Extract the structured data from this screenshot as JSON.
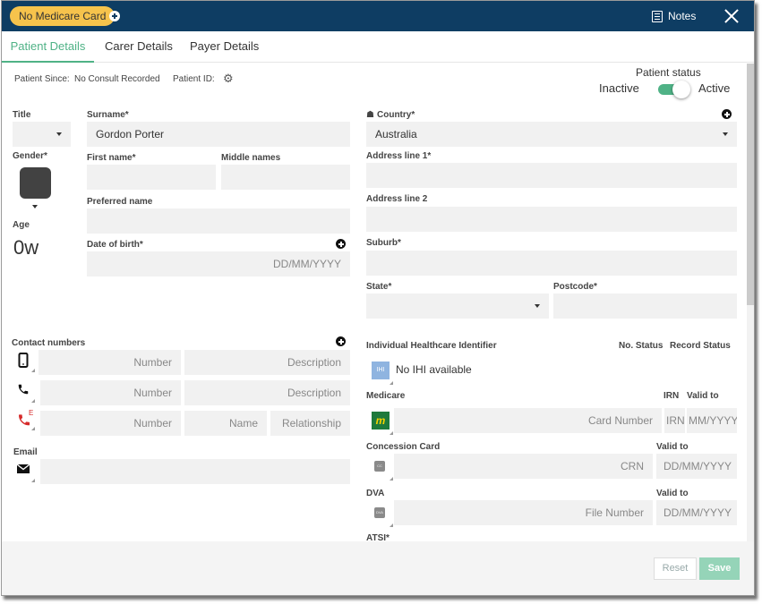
{
  "titlebar": {
    "badge": "No Medicare Card",
    "notes_label": "Notes"
  },
  "tabs": [
    {
      "label": "Patient Details",
      "active": true
    },
    {
      "label": "Carer Details",
      "active": false
    },
    {
      "label": "Payer Details",
      "active": false
    }
  ],
  "meta": {
    "patient_since_label": "Patient Since:",
    "patient_since_value": "No Consult Recorded",
    "patient_id_label": "Patient ID:"
  },
  "status": {
    "title": "Patient status",
    "inactive_label": "Inactive",
    "active_label": "Active",
    "is_active": true
  },
  "colors": {
    "titlebar": "#0e3d63",
    "badge": "#f6c34c",
    "accent": "#4fb286",
    "save_disabled": "#95d4b8"
  },
  "left": {
    "title_label": "Title",
    "title_value": "",
    "gender_label": "Gender*",
    "age_label": "Age",
    "age_value": "0w",
    "surname_label": "Surname*",
    "surname_value": "Gordon Porter",
    "first_name_label": "First name*",
    "first_name_value": "",
    "middle_names_label": "Middle names",
    "middle_names_value": "",
    "preferred_name_label": "Preferred name",
    "preferred_name_value": "",
    "dob_label": "Date of birth*",
    "dob_placeholder": "DD/MM/YYYY"
  },
  "contacts": {
    "label": "Contact numbers",
    "rows": [
      {
        "icon": "mobile-phone-icon",
        "number_placeholder": "Number",
        "description_placeholder": "Description"
      },
      {
        "icon": "phone-icon",
        "number_placeholder": "Number",
        "description_placeholder": "Description"
      },
      {
        "icon": "emergency-phone-icon",
        "number_placeholder": "Number",
        "name_placeholder": "Name",
        "relationship_placeholder": "Relationship"
      }
    ],
    "emergency_badge": "E",
    "email_label": "Email",
    "email_value": ""
  },
  "address": {
    "country_label": "Country*",
    "country_value": "Australia",
    "address1_label": "Address line 1*",
    "address2_label": "Address line 2",
    "suburb_label": "Suburb*",
    "state_label": "State*",
    "state_value": "",
    "postcode_label": "Postcode*"
  },
  "ids": {
    "ihi_label": "Individual Healthcare Identifier",
    "no_status_label": "No. Status",
    "record_status_label": "Record Status",
    "ihi_icon_text": "IHI",
    "ihi_value": "No IHI available",
    "medicare_label": "Medicare",
    "medicare_icon_text": "m",
    "irn_label": "IRN",
    "valid_to_label": "Valid to",
    "card_number_placeholder": "Card Number",
    "irn_placeholder": "IRN",
    "medicare_valid_placeholder": "MM/YYYY",
    "concession_label": "Concession Card",
    "concession_icon_text": "CC",
    "crn_placeholder": "CRN",
    "date_placeholder": "DD/MM/YYYY",
    "dva_label": "DVA",
    "dva_icon_text": "DVA",
    "file_number_placeholder": "File Number",
    "atsi_label": "ATSI*"
  },
  "footer": {
    "reset_label": "Reset",
    "save_label": "Save"
  }
}
